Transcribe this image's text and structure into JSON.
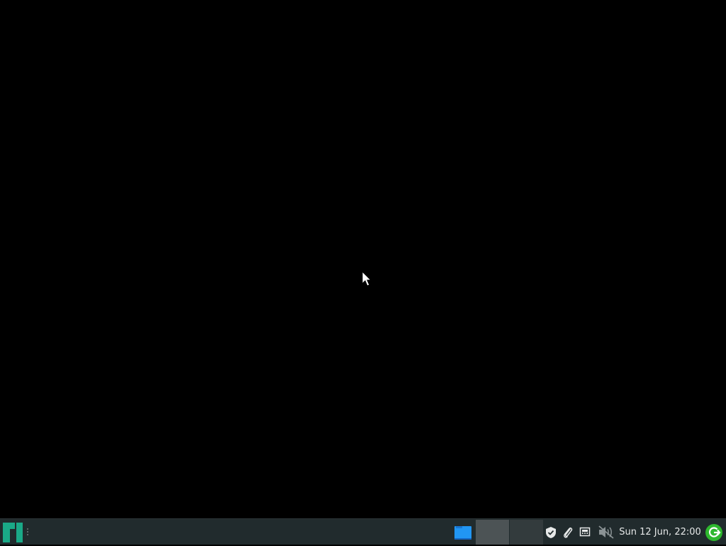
{
  "desktop": {
    "background_color": "#000000"
  },
  "taskbar": {
    "background_color": "#212b2d",
    "menu_icon": "manjaro-logo-icon",
    "accent_color": "#1aa987",
    "launcher_icon": "file-manager-icon",
    "launcher_color": "#2196f3",
    "workspaces": [
      {
        "name": "workspace-1",
        "active": true
      },
      {
        "name": "workspace-2",
        "active": false
      }
    ],
    "tray_icons": [
      "shield-check-icon",
      "paperclip-icon",
      "network-wired-icon",
      "volume-muted-icon"
    ],
    "clock": "Sun 12 Jun, 22:00",
    "update_icon": "update-notifier-icon",
    "update_color": "#2eb82e"
  }
}
